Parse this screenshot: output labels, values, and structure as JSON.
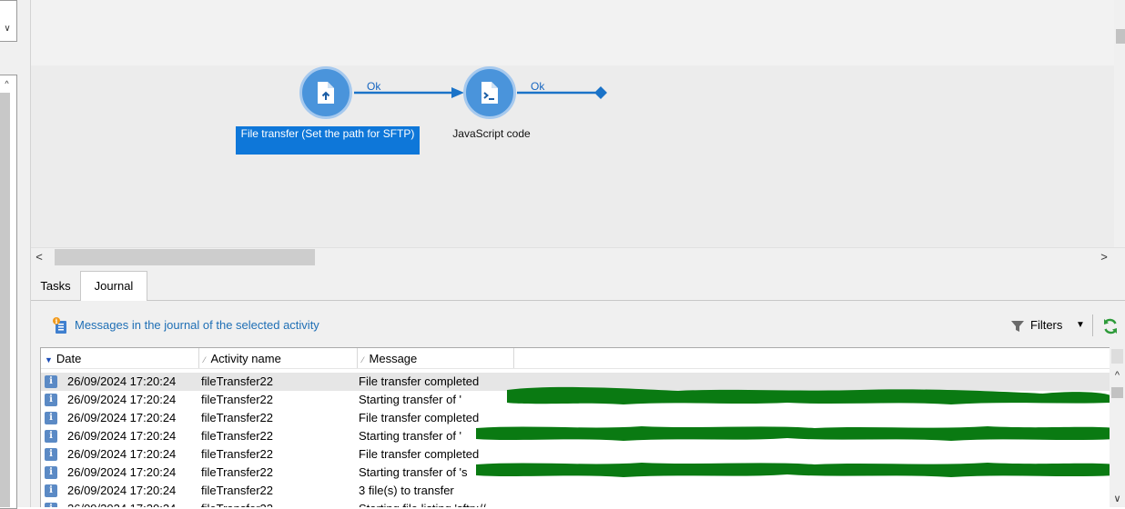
{
  "workflow": {
    "nodes": [
      {
        "label": "File transfer (Set the path for SFTP)",
        "icon": "file-upload-icon",
        "selected": true
      },
      {
        "label": "JavaScript code",
        "icon": "script-icon",
        "selected": false
      }
    ],
    "transitions": [
      {
        "label": "Ok"
      },
      {
        "label": "Ok"
      }
    ],
    "colors": {
      "node": "#4a94db",
      "selected_label_bg": "#0e77d9",
      "arrow": "#1a73c8"
    }
  },
  "tabs": [
    {
      "label": "Tasks",
      "active": false
    },
    {
      "label": "Journal",
      "active": true
    }
  ],
  "journal": {
    "title": "Messages in the journal of the selected activity",
    "filters_label": "Filters",
    "columns": [
      "Date",
      "Activity name",
      "Message"
    ],
    "rows": [
      {
        "date": "26/09/2024 17:20:24",
        "activity": "fileTransfer22",
        "message": "File transfer completed",
        "icon": "info-icon"
      },
      {
        "date": "26/09/2024 17:20:24",
        "activity": "fileTransfer22",
        "message": "Starting transfer of '",
        "icon": "info-icon"
      },
      {
        "date": "26/09/2024 17:20:24",
        "activity": "fileTransfer22",
        "message": "File transfer completed",
        "icon": "info-icon"
      },
      {
        "date": "26/09/2024 17:20:24",
        "activity": "fileTransfer22",
        "message": "Starting transfer of '",
        "icon": "info-icon"
      },
      {
        "date": "26/09/2024 17:20:24",
        "activity": "fileTransfer22",
        "message": "File transfer completed",
        "icon": "info-icon"
      },
      {
        "date": "26/09/2024 17:20:24",
        "activity": "fileTransfer22",
        "message": "Starting transfer of 's",
        "icon": "info-icon"
      },
      {
        "date": "26/09/2024 17:20:24",
        "activity": "fileTransfer22",
        "message": "3 file(s) to transfer",
        "icon": "info-icon"
      },
      {
        "date": "26/09/2024 17:20:24",
        "activity": "fileTransfer22",
        "message": "Starting file listing 'sftp://",
        "icon": "info-icon"
      }
    ],
    "redaction_color": "#0a7a12"
  }
}
